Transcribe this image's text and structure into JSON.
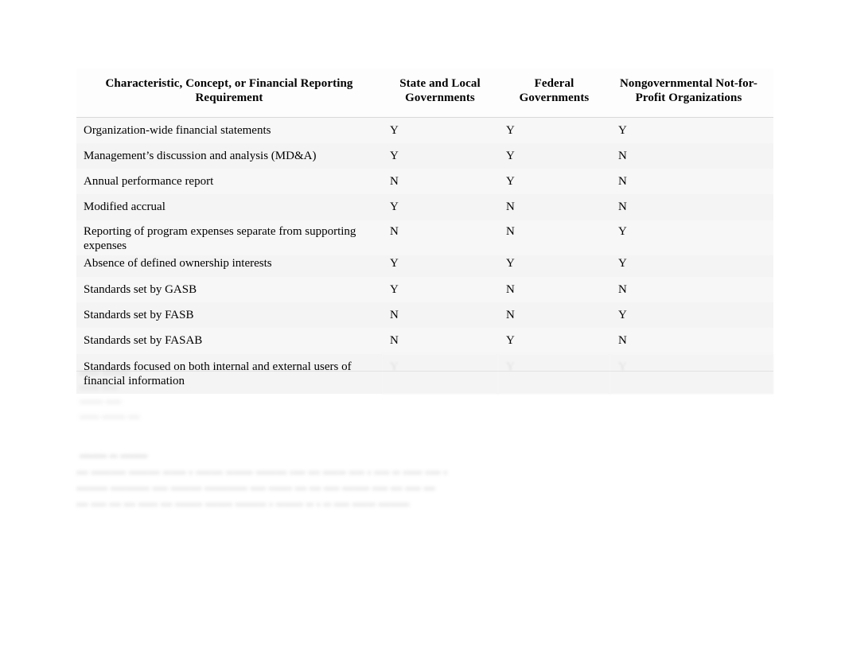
{
  "document": {
    "table": {
      "columns": [
        "Characteristic, Concept, or Financial Reporting Requirement",
        "State and Local Governments",
        "Federal Governments",
        "Nongovernmental Not-for-Profit Organizations"
      ],
      "rows": [
        {
          "characteristic": "Organization-wide financial statements",
          "state_and_local": "Y",
          "federal": "Y",
          "nonprofit": "Y"
        },
        {
          "characteristic": "Management’s discussion and analysis (MD&A)",
          "state_and_local": "Y",
          "federal": "Y",
          "nonprofit": "N"
        },
        {
          "characteristic": "Annual performance report",
          "state_and_local": "N",
          "federal": "Y",
          "nonprofit": "N"
        },
        {
          "characteristic": "Modified accrual",
          "state_and_local": "Y",
          "federal": "N",
          "nonprofit": "N"
        },
        {
          "characteristic": "Reporting of program expenses separate from supporting expenses",
          "state_and_local": "N",
          "federal": "N",
          "nonprofit": "Y"
        },
        {
          "characteristic": "Absence of defined ownership interests",
          "state_and_local": "Y",
          "federal": "Y",
          "nonprofit": "Y"
        },
        {
          "characteristic": "Standards set by GASB",
          "state_and_local": "Y",
          "federal": "N",
          "nonprofit": "N"
        },
        {
          "characteristic": "Standards set by FASB",
          "state_and_local": "N",
          "federal": "N",
          "nonprofit": "Y"
        },
        {
          "characteristic": "Standards set by FASAB",
          "state_and_local": "N",
          "federal": "Y",
          "nonprofit": "N"
        },
        {
          "characteristic": "Standards focused on both internal and external users of financial information",
          "state_and_local": "Y",
          "federal": "Y",
          "nonprofit": "Y"
        }
      ]
    },
    "faded_notes_block": "••••• •••••••\n••••• ••••\n•••••• ••••\n••••• •••••• •••",
    "faded_heading": "•••••••  ••  •••••••",
    "faded_paragraph": "••• ••••••••• •••••••• •••••• • ••••••• ••••••• •••••••• •••• ••• •••••• •••• • •••• •• ••••• •••• •\n•••••••• •••••••••• •••• •••••••• ••••••••••• •••• •••••• ••• ••• •••• ••••••• •••• ••• •••• •••\n••• •••• ••• ••• ••••• ••• ••••••• ••••••• •••••••• • ••••••• •• • •• •••• •••••• ••••••••"
  }
}
